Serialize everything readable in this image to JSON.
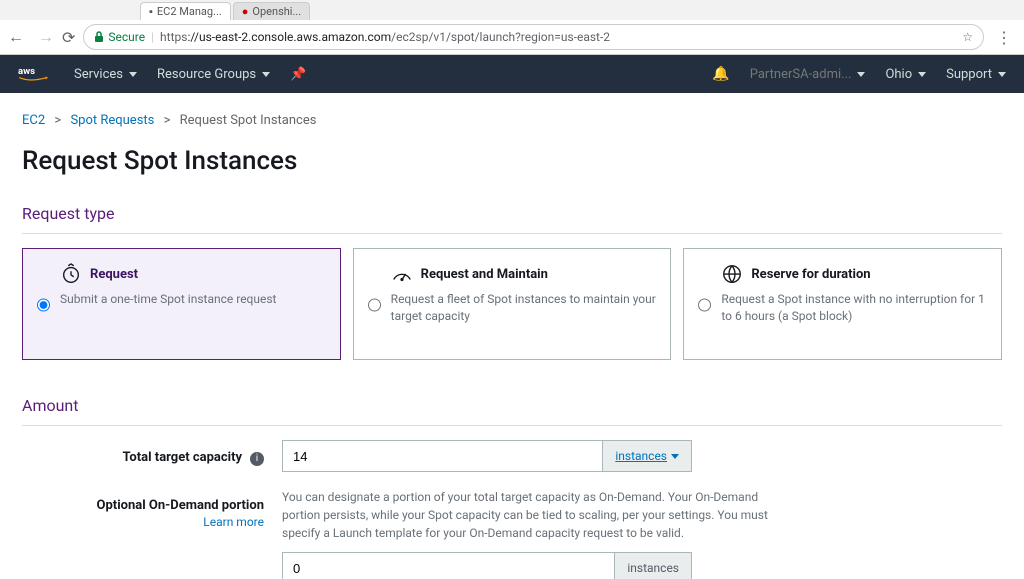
{
  "browser": {
    "tabs": [
      "EC2 Manag...",
      "Openshi..."
    ],
    "secure_label": "Secure",
    "url_proto": "https",
    "url_host": "://us-east-2.console.aws.amazon.com",
    "url_path": "/ec2sp/v1/spot/launch?region=us-east-2"
  },
  "header": {
    "services": "Services",
    "resource_groups": "Resource Groups",
    "user": "PartnerSA-admi...",
    "region": "Ohio",
    "support": "Support"
  },
  "breadcrumbs": {
    "ec2": "EC2",
    "spot_requests": "Spot Requests",
    "current": "Request Spot Instances"
  },
  "title": "Request Spot Instances",
  "request_type": {
    "heading": "Request type",
    "options": [
      {
        "title": "Request",
        "desc": "Submit a one-time Spot instance request"
      },
      {
        "title": "Request and Maintain",
        "desc": "Request a fleet of Spot instances to maintain your target capacity"
      },
      {
        "title": "Reserve for duration",
        "desc": "Request a Spot instance with no interruption for 1 to 6 hours (a Spot block)"
      }
    ]
  },
  "amount": {
    "heading": "Amount",
    "total_label": "Total target capacity",
    "total_value": "14",
    "unit_link": "instances",
    "optional_label": "Optional On-Demand portion",
    "learn_more": "Learn more",
    "optional_help": "You can designate a portion of your total target capacity as On-Demand. Your On-Demand portion persists, while your Spot capacity can be tied to scaling, per your settings. You must specify a Launch template for your On-Demand capacity request to be valid.",
    "optional_value": "0",
    "unit_static": "instances"
  }
}
